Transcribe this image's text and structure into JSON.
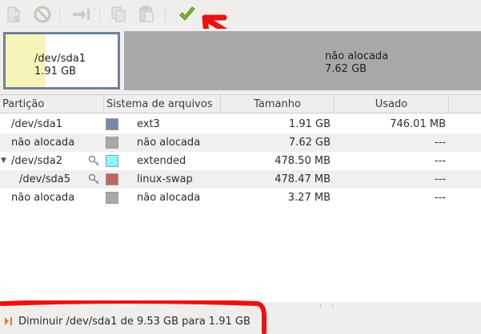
{
  "toolbar": {
    "buttons": [
      {
        "name": "new-partition",
        "icon": "new-document-icon",
        "enabled": false
      },
      {
        "name": "delete-partition",
        "icon": "delete-circle-icon",
        "enabled": false
      },
      {
        "name": "resize-move",
        "icon": "resize-arrow-icon",
        "enabled": false
      },
      {
        "name": "copy",
        "icon": "copy-icon",
        "enabled": false
      },
      {
        "name": "paste",
        "icon": "paste-icon",
        "enabled": false
      },
      {
        "name": "apply",
        "icon": "checkmark-icon",
        "enabled": true
      }
    ]
  },
  "diskmap": {
    "sda1": {
      "name": "/dev/sda1",
      "size": "1.91 GB",
      "used_fraction": 0.36
    },
    "unallocated": {
      "name": "não alocada",
      "size": "7.62 GB"
    }
  },
  "table": {
    "headers": [
      "Partição",
      "Sistema de arquivos",
      "Tamanho",
      "Usado"
    ],
    "rows": [
      {
        "partition": "/dev/sda1",
        "fs": "ext3",
        "fs_color": "#7387a8",
        "size": "1.91 GB",
        "used": "746.01 MB",
        "key": false,
        "expander": false,
        "indent": 0
      },
      {
        "partition": "não alocada",
        "fs": "não alocada",
        "fs_color": "#a8a8a8",
        "size": "7.62 GB",
        "used": "---",
        "key": false,
        "expander": false,
        "indent": 0
      },
      {
        "partition": "/dev/sda2",
        "fs": "extended",
        "fs_color": "#84fbfb",
        "size": "478.50 MB",
        "used": "---",
        "key": true,
        "expander": true,
        "indent": 0
      },
      {
        "partition": "/dev/sda5",
        "fs": "linux-swap",
        "fs_color": "#c1665a",
        "size": "478.47 MB",
        "used": "---",
        "key": true,
        "expander": false,
        "indent": 1
      },
      {
        "partition": "não alocada",
        "fs": "não alocada",
        "fs_color": "#a8a8a8",
        "size": "3.27 MB",
        "used": "---",
        "key": false,
        "expander": false,
        "indent": 0
      }
    ]
  },
  "status": {
    "operation": "Diminuir /dev/sda1 de 9.53 GB para 1.91 GB",
    "icon": "resize-operation-icon"
  },
  "annotations": {
    "color": "#ee1111"
  }
}
